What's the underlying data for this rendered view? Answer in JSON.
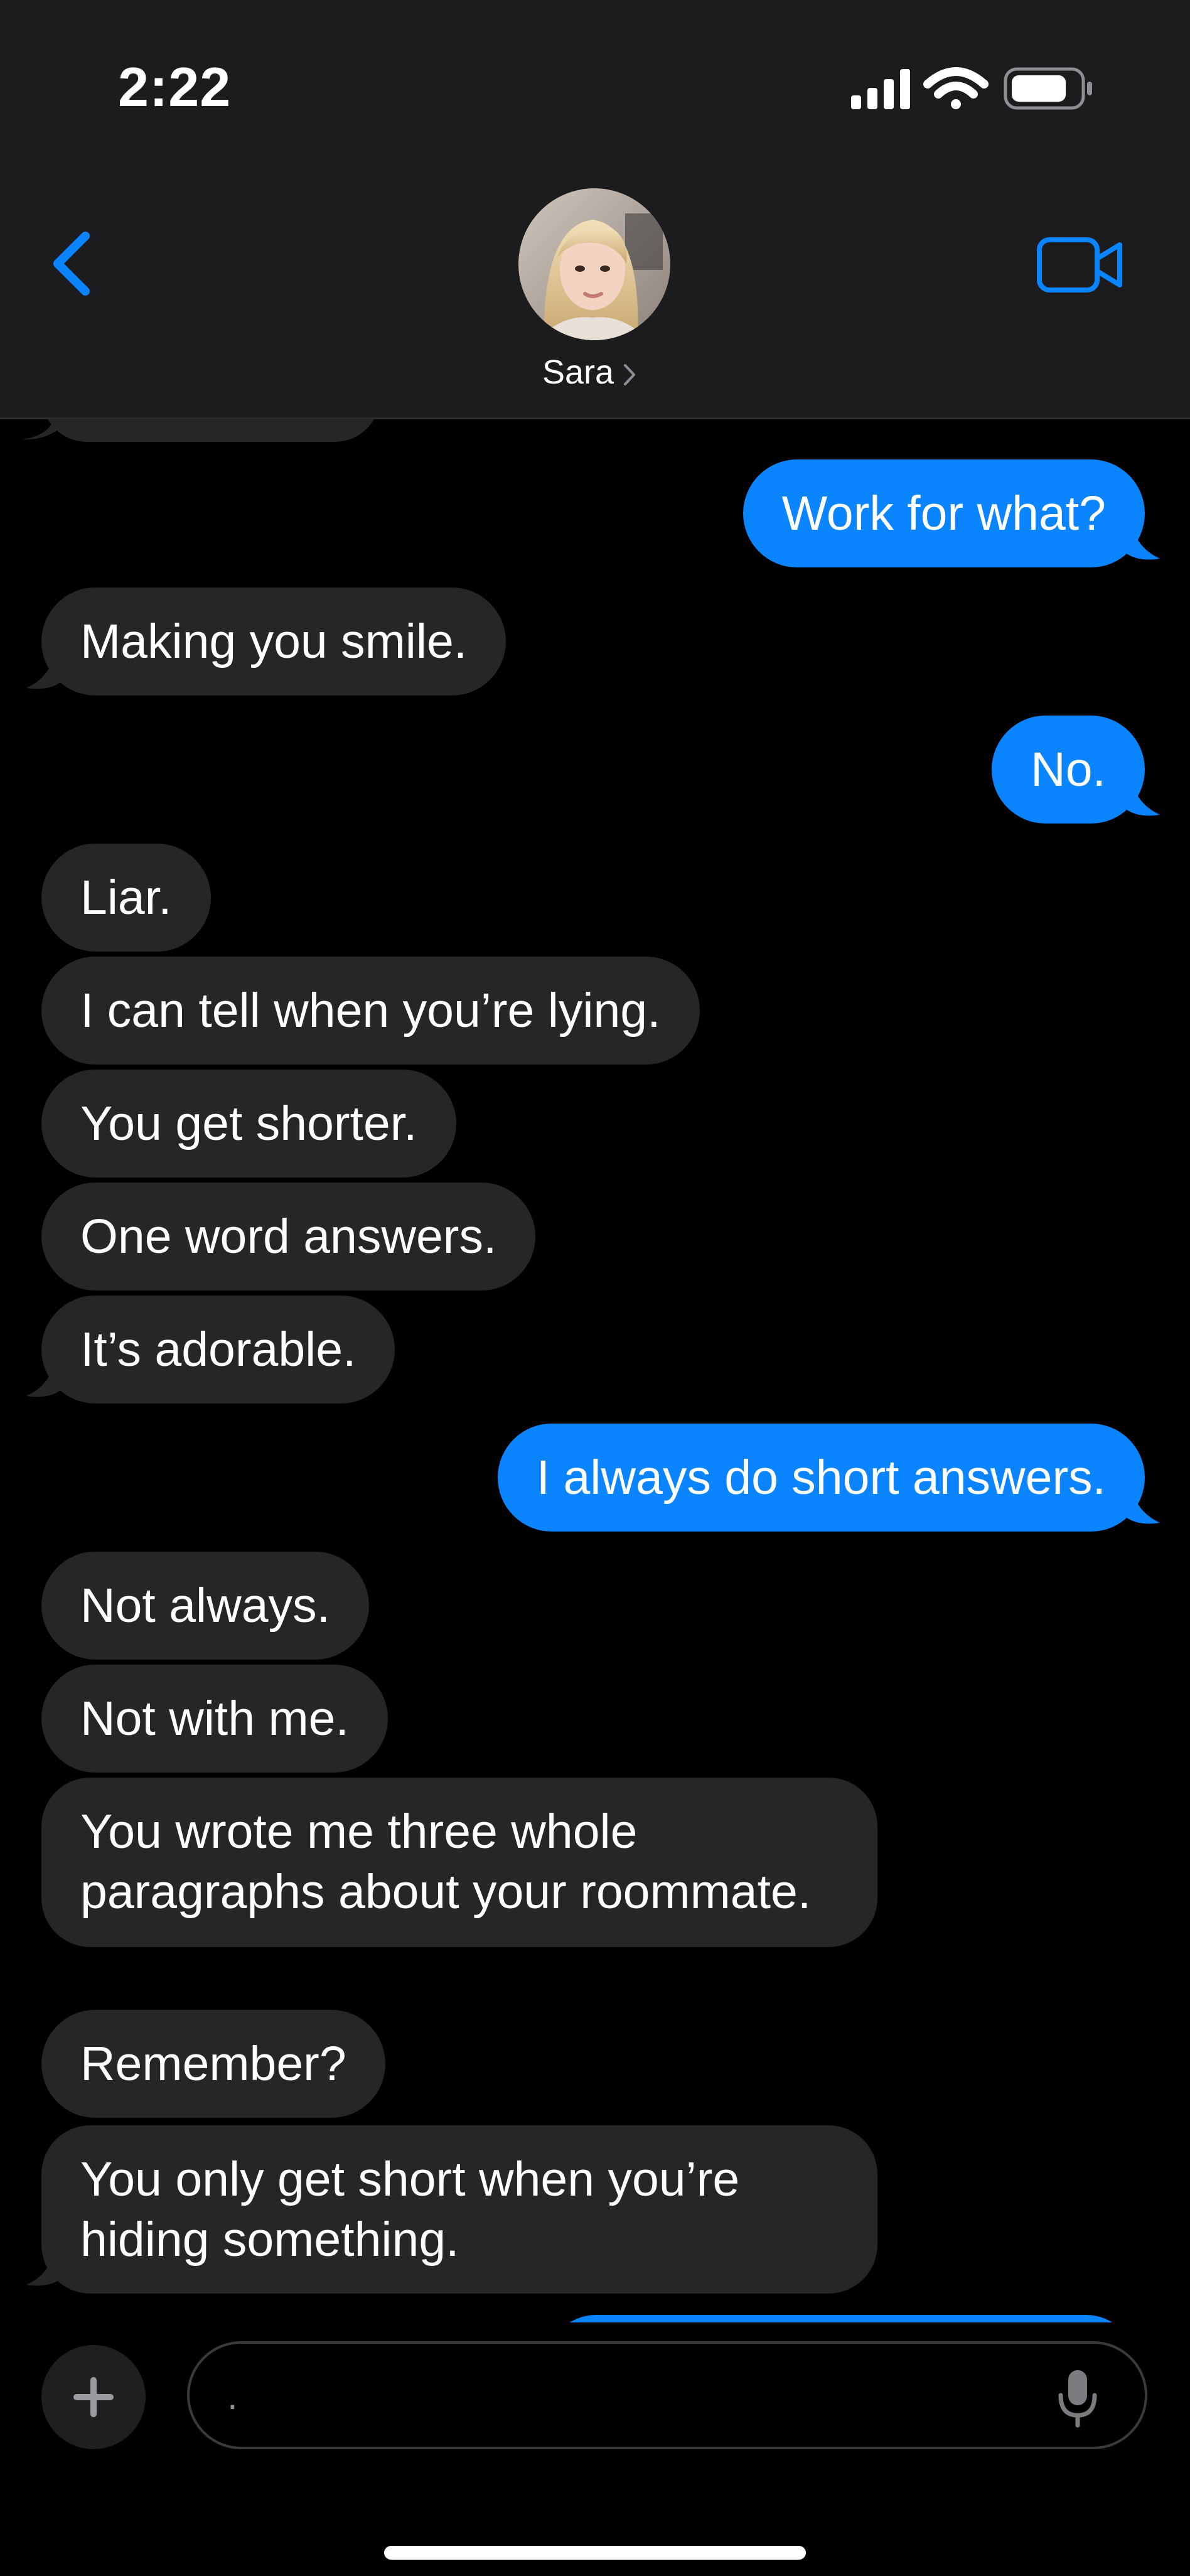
{
  "status_bar": {
    "time": "2:22",
    "icons": [
      "signal-icon",
      "wifi-icon",
      "battery-icon"
    ]
  },
  "header": {
    "back_icon": "chevron-left-icon",
    "contact_name": "Sara",
    "video_icon": "video-camera-icon"
  },
  "colors": {
    "accent": "#0a84ff",
    "incoming_bubble": "#262628",
    "header_bg": "#1c1c1e",
    "background": "#000000"
  },
  "messages": [
    {
      "from": "me",
      "text": "Work for what?"
    },
    {
      "from": "them",
      "text": "Making you smile."
    },
    {
      "from": "me",
      "text": "No."
    },
    {
      "from": "them",
      "text": "Liar."
    },
    {
      "from": "them",
      "text": "I can tell when you’re lying."
    },
    {
      "from": "them",
      "text": "You get shorter."
    },
    {
      "from": "them",
      "text": "One word answers."
    },
    {
      "from": "them",
      "text": "It’s adorable."
    },
    {
      "from": "me",
      "text": "I always do short answers."
    },
    {
      "from": "them",
      "text": "Not always."
    },
    {
      "from": "them",
      "text": "Not with me."
    },
    {
      "from": "them",
      "text": "You wrote me three whole paragraphs about your roommate."
    },
    {
      "from": "them",
      "text": "Remember?"
    },
    {
      "from": "them",
      "text": "You only get short when you’re hiding something."
    }
  ],
  "composer": {
    "add_icon": "plus-icon",
    "placeholder": ".",
    "mic_icon": "microphone-icon"
  }
}
